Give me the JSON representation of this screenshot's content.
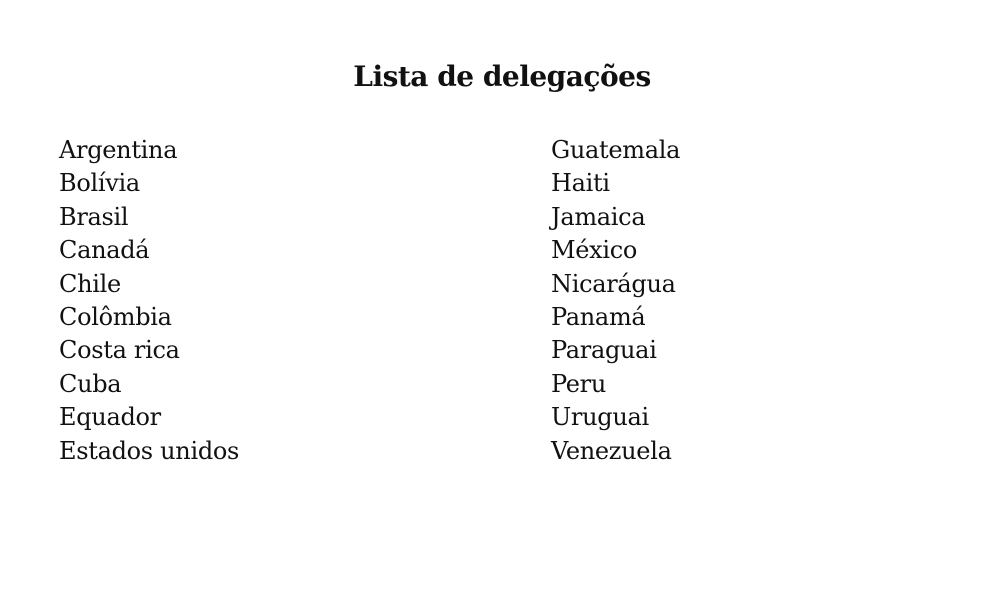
{
  "document": {
    "title": "Lista de delegações",
    "left_column": [
      "Argentina",
      "Bolívia",
      "Brasil",
      "Canadá",
      "Chile",
      "Colômbia",
      "Costa rica",
      "Cuba",
      "Equador",
      "Estados unidos"
    ],
    "right_column": [
      "Guatemala",
      "Haiti",
      "Jamaica",
      "México",
      "Nicarágua",
      "Panamá",
      "Paraguai",
      "Peru",
      "Uruguai",
      "Venezuela"
    ]
  }
}
